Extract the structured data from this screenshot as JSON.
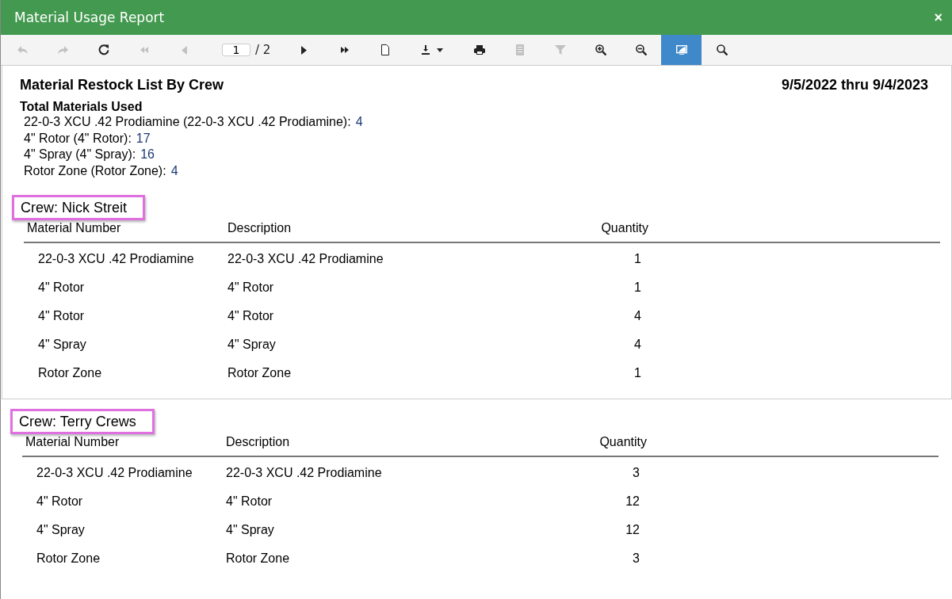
{
  "window": {
    "title": "Material Usage Report",
    "close": "×"
  },
  "toolbar": [
    {
      "kind": "back",
      "disabled": true,
      "selected": false
    },
    {
      "kind": "forward",
      "disabled": true,
      "selected": false
    },
    {
      "kind": "refresh",
      "disabled": false,
      "selected": false
    },
    {
      "kind": "first",
      "disabled": true,
      "selected": false
    },
    {
      "kind": "prev",
      "disabled": true,
      "selected": false
    },
    {
      "kind": "pager",
      "value": "1",
      "total": "/ 2"
    },
    {
      "kind": "next",
      "disabled": false,
      "selected": false
    },
    {
      "kind": "last",
      "disabled": false,
      "selected": false
    },
    {
      "kind": "page",
      "disabled": false,
      "selected": false
    },
    {
      "kind": "download",
      "disabled": false,
      "selected": false
    },
    {
      "kind": "print",
      "disabled": false,
      "selected": false
    },
    {
      "kind": "document",
      "disabled": true,
      "selected": false
    },
    {
      "kind": "filter",
      "disabled": true,
      "selected": false
    },
    {
      "kind": "zoom-in",
      "disabled": false,
      "selected": false
    },
    {
      "kind": "zoom-out",
      "disabled": false,
      "selected": false
    },
    {
      "kind": "display",
      "disabled": false,
      "selected": true
    },
    {
      "kind": "search",
      "disabled": false,
      "selected": false
    }
  ],
  "report": {
    "title": "Material Restock List By Crew",
    "date_range": "9/5/2022 thru 9/4/2023",
    "totals_heading": "Total Materials Used",
    "totals": [
      {
        "label": "22-0-3 XCU .42 Prodiamine (22-0-3 XCU .42 Prodiamine):",
        "value": "4"
      },
      {
        "label": "4\" Rotor (4\" Rotor):",
        "value": "17"
      },
      {
        "label": "4\" Spray (4\" Spray):",
        "value": "16"
      },
      {
        "label": "Rotor Zone (Rotor Zone):",
        "value": "4"
      }
    ],
    "pages": [
      {
        "crews": [
          {
            "heading": "Crew: Nick Streit",
            "highlighted": true,
            "columns": [
              "Material Number",
              "Description",
              "Quantity"
            ],
            "rows": [
              [
                "22-0-3 XCU .42 Prodiamine",
                "22-0-3 XCU .42 Prodiamine",
                "1"
              ],
              [
                "4\" Rotor",
                "4\" Rotor",
                "1"
              ],
              [
                "4\" Rotor",
                "4\" Rotor",
                "4"
              ],
              [
                "4\" Spray",
                "4\" Spray",
                "4"
              ],
              [
                "Rotor Zone",
                "Rotor Zone",
                "1"
              ]
            ]
          }
        ]
      },
      {
        "crews": [
          {
            "heading": "Crew: Terry Crews",
            "highlighted": true,
            "columns": [
              "Material Number",
              "Description",
              "Quantity"
            ],
            "rows": [
              [
                "22-0-3 XCU .42 Prodiamine",
                "22-0-3 XCU .42 Prodiamine",
                "3"
              ],
              [
                "4\" Rotor",
                "4\" Rotor",
                "12"
              ],
              [
                "4\" Spray",
                "4\" Spray",
                "12"
              ],
              [
                "Rotor Zone",
                "Rotor Zone",
                "3"
              ]
            ]
          }
        ]
      }
    ]
  }
}
